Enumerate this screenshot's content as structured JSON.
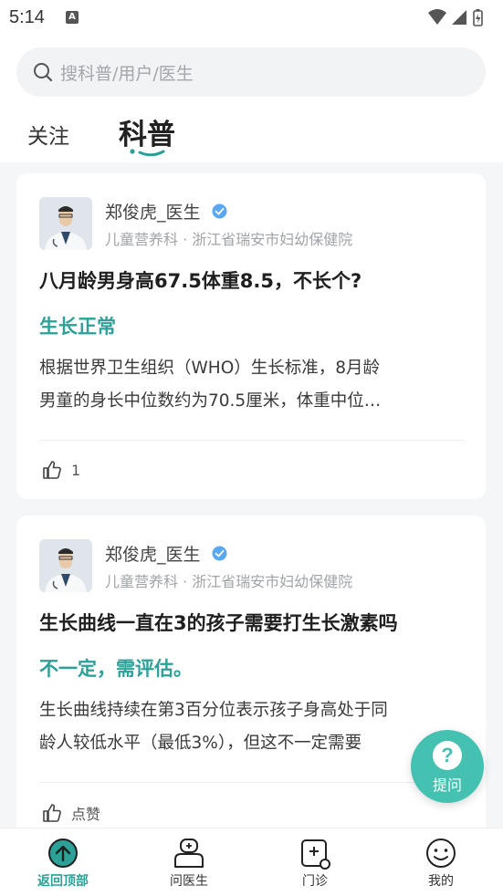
{
  "status_bar": {
    "time": "5:14",
    "notification_icon": "A"
  },
  "search": {
    "placeholder": "搜科普/用户/医生"
  },
  "tabs": [
    {
      "label": "关注",
      "active": false
    },
    {
      "label": "科普",
      "active": true
    }
  ],
  "posts": [
    {
      "doctor_name": "郑俊虎_医生",
      "doctor_meta": "儿童营养科 · 浙江省瑞安市妇幼保健院",
      "question": "八月龄男身高67.5体重8.5，不长个?",
      "answer_summary": "生长正常",
      "body_line1": "根据世界卫生组织（WHO）生长标准，8月龄",
      "body_line2": "男童的身长中位数约为70.5厘米，体重中位…",
      "like_label": "1"
    },
    {
      "doctor_name": "郑俊虎_医生",
      "doctor_meta": "儿童营养科 · 浙江省瑞安市妇幼保健院",
      "question": "生长曲线一直在3的孩子需要打生长激素吗",
      "answer_summary": "不一定，需评估。",
      "body_line1": "生长曲线持续在第3百分位表示孩子身高处于同",
      "body_line2": "龄人较低水平（最低3%），但这不一定需要",
      "like_label": "点赞"
    }
  ],
  "fab": {
    "label": "提问",
    "icon": "question-icon"
  },
  "bottom_nav": [
    {
      "label": "返回顶部",
      "icon": "back-to-top-icon",
      "active": true
    },
    {
      "label": "问医生",
      "icon": "doctor-icon",
      "active": false
    },
    {
      "label": "门诊",
      "icon": "clinic-icon",
      "active": false
    },
    {
      "label": "我的",
      "icon": "smiley-icon",
      "active": false
    }
  ],
  "colors": {
    "accent": "#2ba197",
    "fab": "#45c1b2",
    "verified": "#5aa9f0"
  }
}
